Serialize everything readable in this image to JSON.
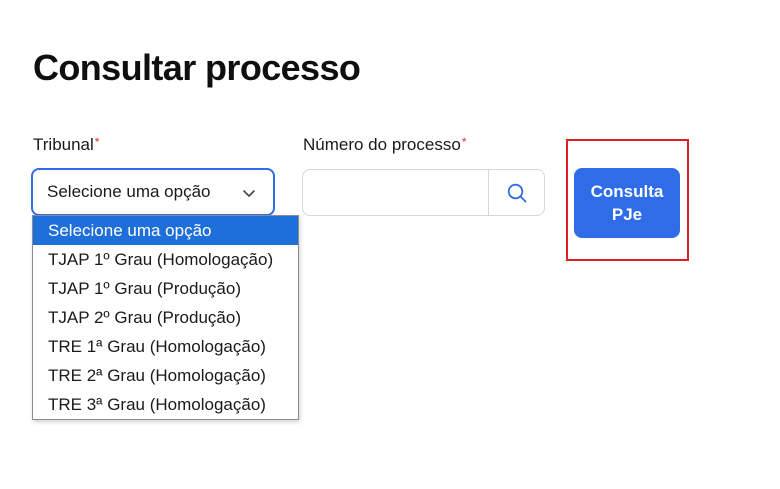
{
  "page": {
    "title": "Consultar processo"
  },
  "form": {
    "tribunal": {
      "label": "Tribunal",
      "required_mark": "*",
      "selected_value": "Selecione uma opção",
      "options": [
        "Selecione uma opção",
        "TJAP 1º Grau (Homologação)",
        "TJAP 1º Grau (Produção)",
        "TJAP 2º Grau (Produção)",
        "TRE 1ª Grau (Homologação)",
        "TRE 2ª Grau (Homologação)",
        "TRE 3ª Grau (Homologação)"
      ],
      "highlighted_option_index": 0
    },
    "numero": {
      "label": "Número do processo",
      "required_mark": "*",
      "value": "",
      "placeholder": ""
    },
    "submit_label": "Consulta PJe"
  },
  "icons": {
    "select_chevron": "chevron-down-icon",
    "search": "search-icon"
  },
  "colors": {
    "accent": "#2f6ce8",
    "focus_border": "#2f6fe6",
    "option_highlight": "#1e6fd9",
    "required": "#d9342b",
    "annotation_box": "#e02020"
  }
}
